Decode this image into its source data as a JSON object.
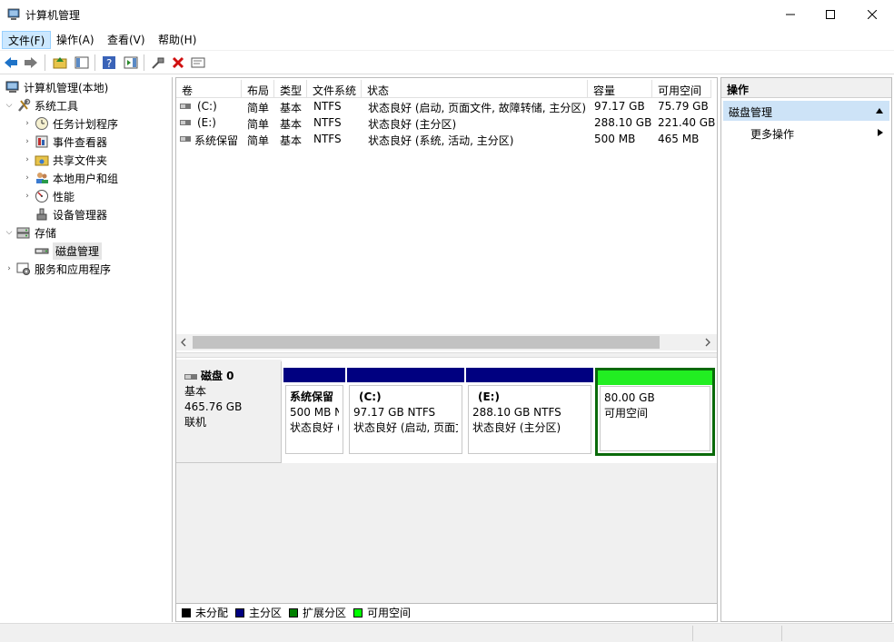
{
  "window": {
    "title": "计算机管理",
    "minimize": "—",
    "maximize": "☐",
    "close": "✕"
  },
  "menu": [
    {
      "label": "文件(F)"
    },
    {
      "label": "操作(A)"
    },
    {
      "label": "查看(V)"
    },
    {
      "label": "帮助(H)"
    }
  ],
  "toolbar_icons": [
    "back-icon",
    "forward-icon",
    "up-folder-icon",
    "show-hide-tree-icon",
    "help-icon",
    "show-action-pane-icon",
    "connect-icon",
    "delete-icon",
    "properties-icon"
  ],
  "tree": {
    "root": "计算机管理(本地)",
    "system_tools": "系统工具",
    "task_scheduler": "任务计划程序",
    "event_viewer": "事件查看器",
    "shared_folders": "共享文件夹",
    "local_users": "本地用户和组",
    "performance": "性能",
    "device_manager": "设备管理器",
    "storage": "存储",
    "disk_management": "磁盘管理",
    "services": "服务和应用程序"
  },
  "volume_table": {
    "headers": {
      "volume": "卷",
      "layout": "布局",
      "type": "类型",
      "fs": "文件系统",
      "status": "状态",
      "capacity": "容量",
      "free": "可用空间"
    },
    "rows": [
      {
        "volume": "(C:)",
        "layout": "简单",
        "type": "基本",
        "fs": "NTFS",
        "status": "状态良好 (启动, 页面文件, 故障转储, 主分区)",
        "capacity": "97.17 GB",
        "free": "75.79 GB"
      },
      {
        "volume": "(E:)",
        "layout": "简单",
        "type": "基本",
        "fs": "NTFS",
        "status": "状态良好 (主分区)",
        "capacity": "288.10 GB",
        "free": "221.40 GB"
      },
      {
        "volume": "系统保留",
        "layout": "简单",
        "type": "基本",
        "fs": "NTFS",
        "status": "状态良好 (系统, 活动, 主分区)",
        "capacity": "500 MB",
        "free": "465 MB"
      }
    ]
  },
  "disk": {
    "name": "磁盘 0",
    "kind": "基本",
    "size": "465.76 GB",
    "state": "联机",
    "partitions": [
      {
        "name": "系统保留",
        "line1": "500 MB N",
        "line2": "状态良好 (",
        "bar_color": "#000080"
      },
      {
        "name": "(C:)",
        "line1": "97.17 GB NTFS",
        "line2": "状态良好 (启动, 页面文",
        "bar_color": "#000080"
      },
      {
        "name": "(E:)",
        "line1": "288.10 GB NTFS",
        "line2": "状态良好 (主分区)",
        "bar_color": "#000080"
      },
      {
        "name": "",
        "line1": "80.00 GB",
        "line2": "可用空间",
        "bar_color": "#00ff00"
      }
    ]
  },
  "legend": [
    {
      "label": "未分配",
      "color": "#000000"
    },
    {
      "label": "主分区",
      "color": "#000080"
    },
    {
      "label": "扩展分区",
      "color": "#008000"
    },
    {
      "label": "可用空间",
      "color": "#00ff00"
    }
  ],
  "actions": {
    "header": "操作",
    "section": "磁盘管理",
    "more": "更多操作"
  }
}
